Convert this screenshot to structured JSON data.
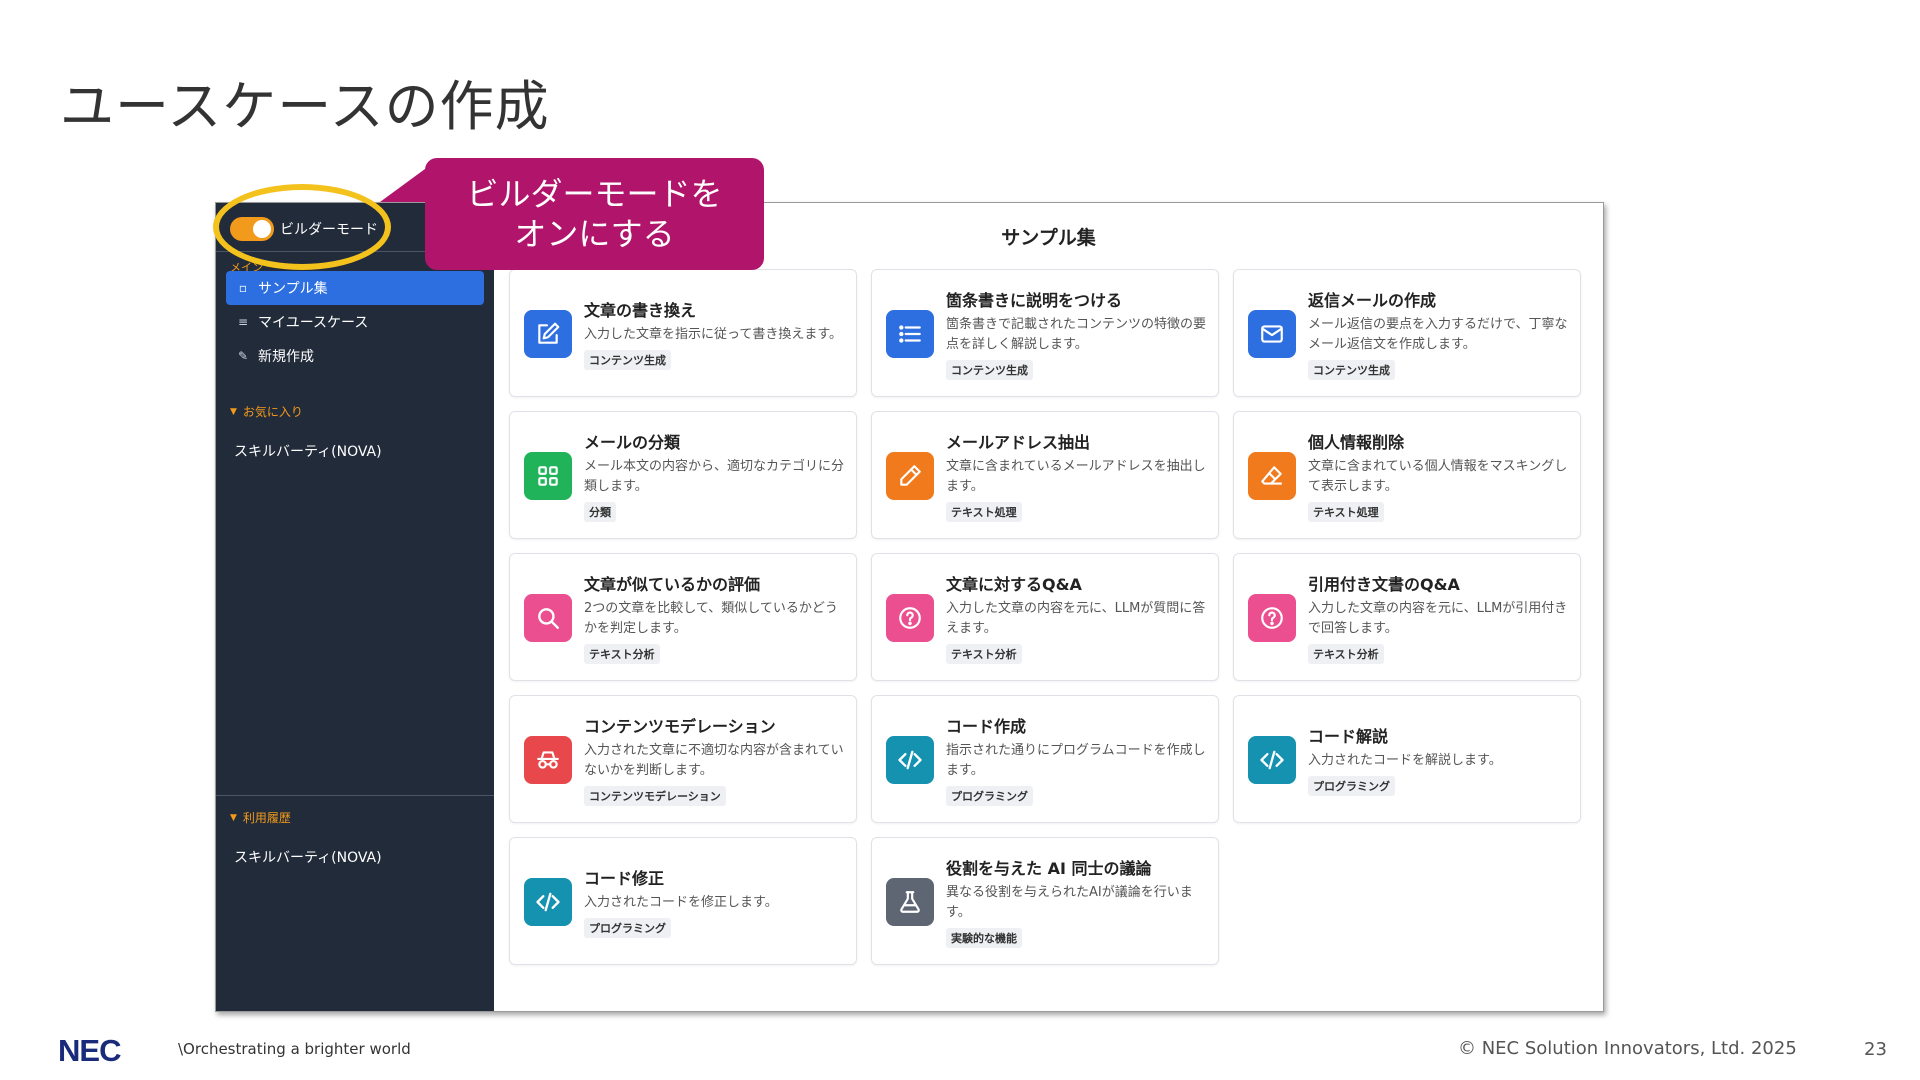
{
  "slide": {
    "title": "ユースケースの作成",
    "page_number": "23",
    "copyright": "© NEC Solution Innovators, Ltd. 2025",
    "logo_text": "NEC",
    "tagline": "\\Orchestrating a brighter world"
  },
  "annotation": {
    "callout_line1": "ビルダーモードを",
    "callout_line2": "オンにする",
    "highlight_color": "#f3c21d",
    "callout_color": "#b0146b"
  },
  "sidebar": {
    "builder_mode_label": "ビルダーモード",
    "builder_mode_on": true,
    "menu_heading": "メイン",
    "nav": [
      {
        "label": "サンプル集",
        "icon": "book-open-icon",
        "active": true
      },
      {
        "label": "マイユースケース",
        "icon": "list-icon",
        "active": false
      },
      {
        "label": "新規作成",
        "icon": "edit-icon",
        "active": false
      }
    ],
    "favorites_heading": "お気に入り",
    "favorites": [
      "スキルバーティ(NOVA)"
    ],
    "history_heading": "利用履歴",
    "history": [
      "スキルバーティ(NOVA)"
    ]
  },
  "main": {
    "title": "サンプル集",
    "cards": [
      {
        "title": "文章の書き換え",
        "desc": "入力した文章を指示に従って書き換えます。",
        "tag": "コンテンツ生成",
        "icon": "edit-square-icon",
        "color": "blue"
      },
      {
        "title": "箇条書きに説明をつける",
        "desc": "箇条書きで記載されたコンテンツの特徴の要点を詳しく解説します。",
        "tag": "コンテンツ生成",
        "icon": "list-icon",
        "color": "blue"
      },
      {
        "title": "返信メールの作成",
        "desc": "メール返信の要点を入力するだけで、丁寧なメール返信文を作成します。",
        "tag": "コンテンツ生成",
        "icon": "mail-icon",
        "color": "blue"
      },
      {
        "title": "メールの分類",
        "desc": "メール本文の内容から、適切なカテゴリに分類します。",
        "tag": "分類",
        "icon": "grid-icon",
        "color": "green"
      },
      {
        "title": "メールアドレス抽出",
        "desc": "文章に含まれているメールアドレスを抽出します。",
        "tag": "テキスト処理",
        "icon": "eyedropper-icon",
        "color": "orange"
      },
      {
        "title": "個人情報削除",
        "desc": "文章に含まれている個人情報をマスキングして表示します。",
        "tag": "テキスト処理",
        "icon": "eraser-icon",
        "color": "orange"
      },
      {
        "title": "文章が似ているかの評価",
        "desc": "2つの文章を比較して、類似しているかどうかを判定します。",
        "tag": "テキスト分析",
        "icon": "search-icon",
        "color": "pink"
      },
      {
        "title": "文章に対するQ&A",
        "desc": "入力した文章の内容を元に、LLMが質問に答えます。",
        "tag": "テキスト分析",
        "icon": "question-icon",
        "color": "pink"
      },
      {
        "title": "引用付き文書のQ&A",
        "desc": "入力した文章の内容を元に、LLMが引用付きで回答します。",
        "tag": "テキスト分析",
        "icon": "question-icon",
        "color": "pink"
      },
      {
        "title": "コンテンツモデレーション",
        "desc": "入力された文章に不適切な内容が含まれていないかを判断します。",
        "tag": "コンテンツモデレーション",
        "icon": "spy-icon",
        "color": "red"
      },
      {
        "title": "コード作成",
        "desc": "指示された通りにプログラムコードを作成します。",
        "tag": "プログラミング",
        "icon": "code-icon",
        "color": "teal"
      },
      {
        "title": "コード解説",
        "desc": "入力されたコードを解説します。",
        "tag": "プログラミング",
        "icon": "code-icon",
        "color": "teal"
      },
      {
        "title": "コード修正",
        "desc": "入力されたコードを修正します。",
        "tag": "プログラミング",
        "icon": "code-icon",
        "color": "teal"
      },
      {
        "title": "役割を与えた AI 同士の議論",
        "desc": "異なる役割を与えられたAIが議論を行います。",
        "tag": "実験的な機能",
        "icon": "flask-icon",
        "color": "gray"
      }
    ]
  }
}
